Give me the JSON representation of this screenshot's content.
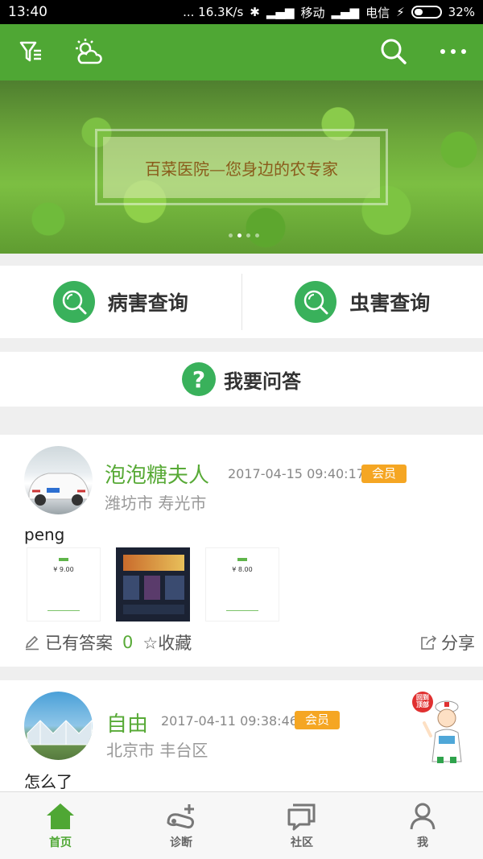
{
  "status_bar": {
    "time": "13:40",
    "network_speed": "... 16.3K/s",
    "carrier1": "移动",
    "carrier2": "电信",
    "battery": "32%"
  },
  "toolbar": {
    "icons": [
      "filter-icon",
      "weather-icon",
      "search-icon",
      "more-icon"
    ]
  },
  "banner": {
    "text": "百菜医院—您身边的农专家",
    "slides": 4,
    "active_slide": 1
  },
  "query": {
    "disease_label": "病害查询",
    "pest_label": "虫害查询"
  },
  "qa": {
    "label": "我要问答"
  },
  "posts": [
    {
      "user": "泡泡糖夫人",
      "time": "2017-04-15 09:40:17",
      "badge": "会员",
      "location": "潍坊市 寿光市",
      "content": "peng",
      "answers_label": "已有答案",
      "answers_count": "0",
      "favorite_label": "☆收藏",
      "share_label": "分享",
      "thumbs": [
        "¥ 9.00",
        "",
        "¥ 8.00"
      ]
    },
    {
      "user": "自由",
      "time": "2017-04-11 09:38:46",
      "badge": "会员",
      "location": "北京市 丰台区",
      "content": "怎么了"
    }
  ],
  "back_to_top": "回到顶部",
  "bottom_nav": [
    {
      "label": "首页",
      "active": true
    },
    {
      "label": "诊断",
      "active": false
    },
    {
      "label": "社区",
      "active": false
    },
    {
      "label": "我",
      "active": false
    }
  ],
  "colors": {
    "primary_green": "#4fa734",
    "icon_green": "#39b15b",
    "badge_orange": "#f5a623"
  }
}
